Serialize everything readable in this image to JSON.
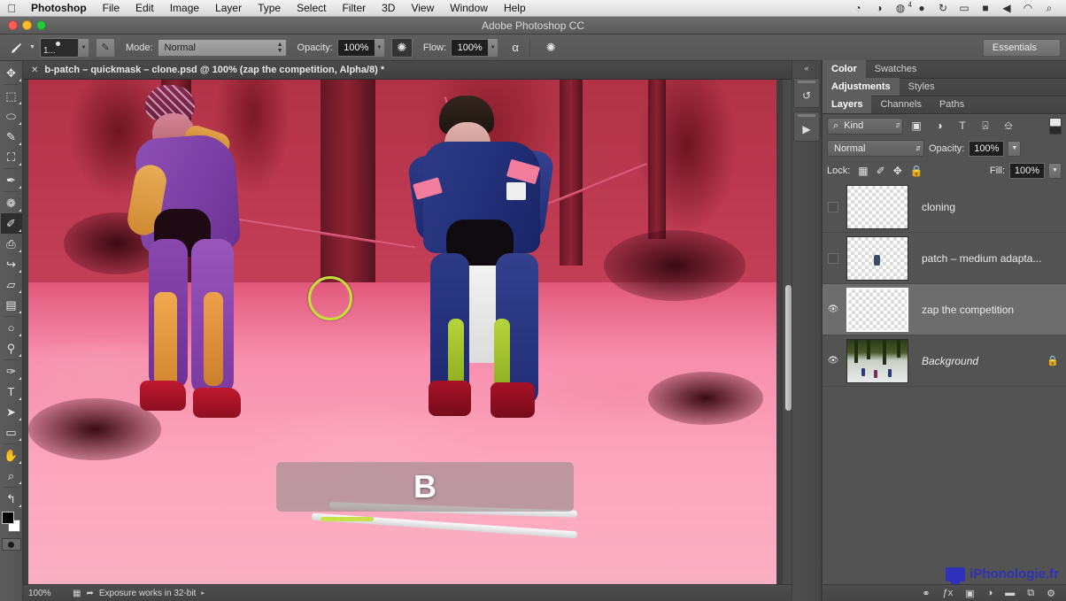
{
  "os_bar": {
    "apple_icon": "apple-icon",
    "menus": [
      {
        "label": "Photoshop",
        "bold": true
      },
      {
        "label": "File",
        "bold": false
      },
      {
        "label": "Edit",
        "bold": false
      },
      {
        "label": "Image",
        "bold": false
      },
      {
        "label": "Layer",
        "bold": false
      },
      {
        "label": "Type",
        "bold": false
      },
      {
        "label": "Select",
        "bold": false
      },
      {
        "label": "Filter",
        "bold": false
      },
      {
        "label": "3D",
        "bold": false
      },
      {
        "label": "View",
        "bold": false
      },
      {
        "label": "Window",
        "bold": false
      },
      {
        "label": "Help",
        "bold": false
      }
    ],
    "status_icons": [
      {
        "name": "dropbox-icon",
        "glyph": "◔",
        "badge": ""
      },
      {
        "name": "time-machine-icon",
        "glyph": "◑",
        "badge": ""
      },
      {
        "name": "cloud-sync-icon",
        "glyph": "◍",
        "badge": "4"
      },
      {
        "name": "creative-cloud-icon",
        "glyph": "●",
        "badge": ""
      },
      {
        "name": "sync-icon",
        "glyph": "↻",
        "badge": ""
      },
      {
        "name": "battery-icon",
        "glyph": "▭",
        "badge": ""
      },
      {
        "name": "display-icon",
        "glyph": "■",
        "badge": ""
      },
      {
        "name": "volume-icon",
        "glyph": "◀",
        "badge": ""
      },
      {
        "name": "wifi-icon",
        "glyph": "◠",
        "badge": ""
      },
      {
        "name": "spotlight-search-icon",
        "glyph": "⌕",
        "badge": ""
      }
    ]
  },
  "title_bar": {
    "app_title": "Adobe Photoshop CC",
    "traffic_lights": [
      {
        "name": "close-button",
        "color": "#ff5f57"
      },
      {
        "name": "minimize-button",
        "color": "#ffbd2e"
      },
      {
        "name": "zoom-button",
        "color": "#28c940"
      }
    ]
  },
  "options_bar": {
    "tool_icon": "brush-tool-icon",
    "brush_preset_size": "1...",
    "tablet_pressure_icon": "tablet-pressure-icon",
    "mode_label": "Mode:",
    "mode_value": "Normal",
    "opacity_label": "Opacity:",
    "opacity_value": "100%",
    "opacity_pressure_icon": "opacity-pressure-icon",
    "flow_label": "Flow:",
    "flow_value": "100%",
    "airbrush_icon": "airbrush-icon",
    "smoothing_icon": "brush-smoothing-icon",
    "workspace": "Essentials"
  },
  "toolbar": {
    "tools": [
      {
        "name": "move-tool",
        "glyph": "✥",
        "active": false
      },
      {
        "name": "rectangular-marquee-tool",
        "glyph": "⬚",
        "active": false
      },
      {
        "name": "lasso-tool",
        "glyph": "⬭",
        "active": false
      },
      {
        "name": "quick-selection-tool",
        "glyph": "✎",
        "active": false
      },
      {
        "name": "crop-tool",
        "glyph": "⛶",
        "active": false
      },
      {
        "name": "eyedropper-tool",
        "glyph": "✒",
        "active": false
      },
      {
        "name": "spot-healing-brush-tool",
        "glyph": "❁",
        "active": false
      },
      {
        "name": "brush-tool",
        "glyph": "✐",
        "active": true
      },
      {
        "name": "clone-stamp-tool",
        "glyph": "⎙",
        "active": false
      },
      {
        "name": "history-brush-tool",
        "glyph": "↪",
        "active": false
      },
      {
        "name": "eraser-tool",
        "glyph": "▱",
        "active": false
      },
      {
        "name": "gradient-tool",
        "glyph": "▤",
        "active": false
      },
      {
        "name": "blur-tool",
        "glyph": "○",
        "active": false
      },
      {
        "name": "dodge-tool",
        "glyph": "⚲",
        "active": false
      },
      {
        "name": "pen-tool",
        "glyph": "✑",
        "active": false
      },
      {
        "name": "type-tool",
        "glyph": "T",
        "active": false
      },
      {
        "name": "path-selection-tool",
        "glyph": "➤",
        "active": false
      },
      {
        "name": "rectangle-shape-tool",
        "glyph": "▭",
        "active": false
      },
      {
        "name": "hand-tool",
        "glyph": "✋",
        "active": false
      },
      {
        "name": "zoom-tool",
        "glyph": "⌕",
        "active": false
      },
      {
        "name": "edit-toolbar-button",
        "glyph": "↰",
        "active": false
      }
    ],
    "foreground_color": "#000000",
    "background_color": "#ffffff",
    "quick_mask_icon": "quick-mask-mode-icon"
  },
  "document": {
    "tab_close_icon": "close-tab-icon",
    "tab_title": "b-patch – quickmask – clone.psd @ 100% (zap the competition, Alpha/8) *",
    "keystroke_overlay": "B",
    "brush_cursor": "brush-cursor-circle",
    "brush_cursor_color": "#c3e037"
  },
  "status_bar": {
    "zoom": "100%",
    "doc_icon": "document-icon",
    "share_icon": "share-icon",
    "message": "Exposure works in 32-bit",
    "expand_arrow": "▸"
  },
  "mini_dock": {
    "collapse_icon": "collapse-panels-icon",
    "buttons": [
      {
        "name": "history-panel-icon",
        "glyph": "↺"
      },
      {
        "name": "actions-panel-icon",
        "glyph": "▶"
      }
    ]
  },
  "panels": {
    "group1_tabs": [
      {
        "label": "Color",
        "active": true
      },
      {
        "label": "Swatches",
        "active": false
      }
    ],
    "group2_tabs": [
      {
        "label": "Adjustments",
        "active": true
      },
      {
        "label": "Styles",
        "active": false
      }
    ],
    "group3_tabs": [
      {
        "label": "Layers",
        "active": true
      },
      {
        "label": "Channels",
        "active": false
      },
      {
        "label": "Paths",
        "active": false
      }
    ]
  },
  "layers_panel": {
    "filter_label": "Kind",
    "filter_search_icon": "search-icon",
    "filter_buttons": [
      {
        "name": "filter-pixel-layers-icon",
        "glyph": "⛰"
      },
      {
        "name": "filter-adjustment-layers-icon",
        "glyph": "◑"
      },
      {
        "name": "filter-type-layers-icon",
        "glyph": "T"
      },
      {
        "name": "filter-shape-layers-icon",
        "glyph": "⌧"
      },
      {
        "name": "filter-smart-objects-icon",
        "glyph": "⬒"
      }
    ],
    "filter_toggle": "filter-enable-toggle",
    "blend_mode": "Normal",
    "opacity_label": "Opacity:",
    "opacity_value": "100%",
    "lock_label": "Lock:",
    "lock_buttons": [
      {
        "name": "lock-transparent-pixels-icon",
        "glyph": "▒"
      },
      {
        "name": "lock-image-pixels-icon",
        "glyph": "✐"
      },
      {
        "name": "lock-position-icon",
        "glyph": "✥"
      },
      {
        "name": "lock-all-icon",
        "glyph": "ὑ2"
      }
    ],
    "fill_label": "Fill:",
    "fill_value": "100%",
    "layers": [
      {
        "name": "cloning",
        "visible": false,
        "selected": false,
        "locked": false,
        "italic": false,
        "thumb_type": "transparent"
      },
      {
        "name": "patch – medium adapta...",
        "visible": false,
        "selected": false,
        "locked": false,
        "italic": false,
        "thumb_type": "transparent-with-figure"
      },
      {
        "name": "zap the competition",
        "visible": true,
        "selected": true,
        "locked": false,
        "italic": false,
        "thumb_type": "transparent"
      },
      {
        "name": "Background",
        "visible": true,
        "selected": false,
        "locked": true,
        "italic": true,
        "thumb_type": "photo"
      }
    ],
    "footer_buttons": [
      {
        "name": "link-layers-icon",
        "glyph": "⚭"
      },
      {
        "name": "layer-styles-icon",
        "glyph": "ƒх"
      },
      {
        "name": "add-layer-mask-icon",
        "glyph": "▣"
      },
      {
        "name": "new-adjustment-layer-icon",
        "glyph": "◑"
      },
      {
        "name": "new-group-icon",
        "glyph": "▰"
      },
      {
        "name": "new-layer-icon",
        "glyph": "⧉"
      },
      {
        "name": "delete-layer-icon",
        "glyph": "Ὕ1"
      }
    ]
  },
  "watermark": {
    "icon": "monitor-icon",
    "text": "iPhonologie.fr",
    "color": "#2b2ccc"
  }
}
